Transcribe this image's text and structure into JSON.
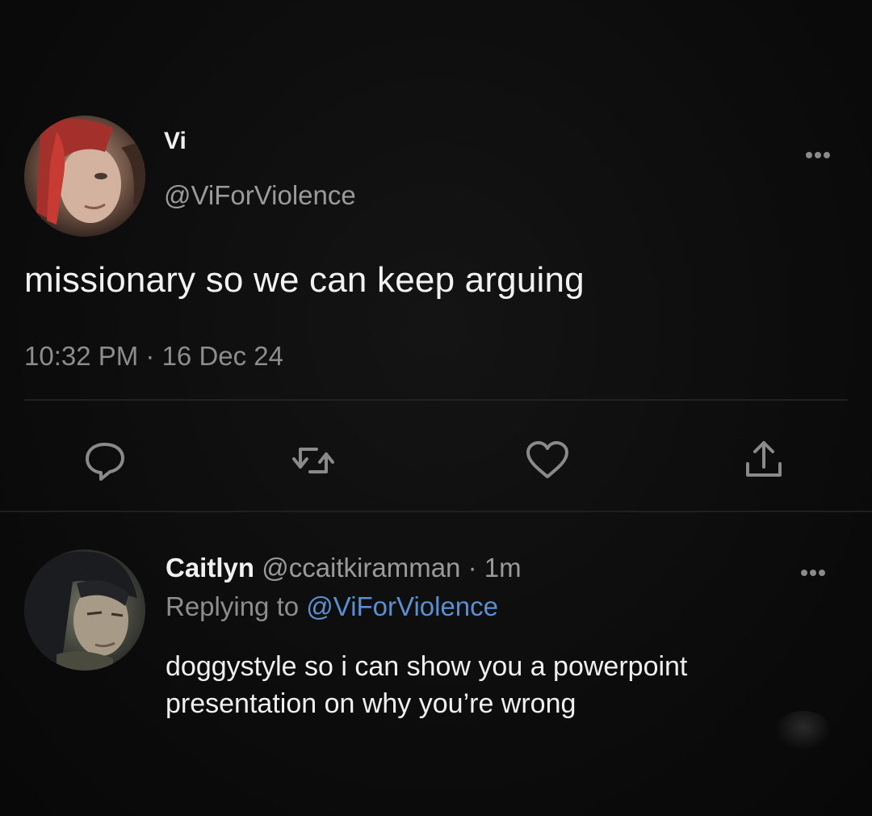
{
  "theme": {
    "background": "#0d0d0d",
    "text_primary": "#f0f0f0",
    "text_secondary": "#8d8d8d",
    "link": "#5b8fd0"
  },
  "tweet": {
    "author_name": "Vi",
    "author_handle": "@ViForViolence",
    "text": "missionary so we can keep arguing",
    "timestamp": "10:32 PM · 16 Dec 24",
    "avatar_icon": "avatar-vi-icon",
    "more_icon": "more-options-icon"
  },
  "actions": [
    {
      "name": "reply",
      "icon": "reply-icon"
    },
    {
      "name": "retweet",
      "icon": "retweet-icon"
    },
    {
      "name": "like",
      "icon": "heart-icon"
    },
    {
      "name": "share",
      "icon": "share-icon"
    }
  ],
  "reply": {
    "author_name": "Caitlyn",
    "author_handle": "@ccaitkiramman · 1m",
    "replying_prefix": "Replying to",
    "replying_to": "@ViForViolence",
    "text": "doggystyle so i can show you a powerpoint presentation on why you’re wrong",
    "avatar_icon": "avatar-caitlyn-icon",
    "more_icon": "more-options-icon"
  }
}
